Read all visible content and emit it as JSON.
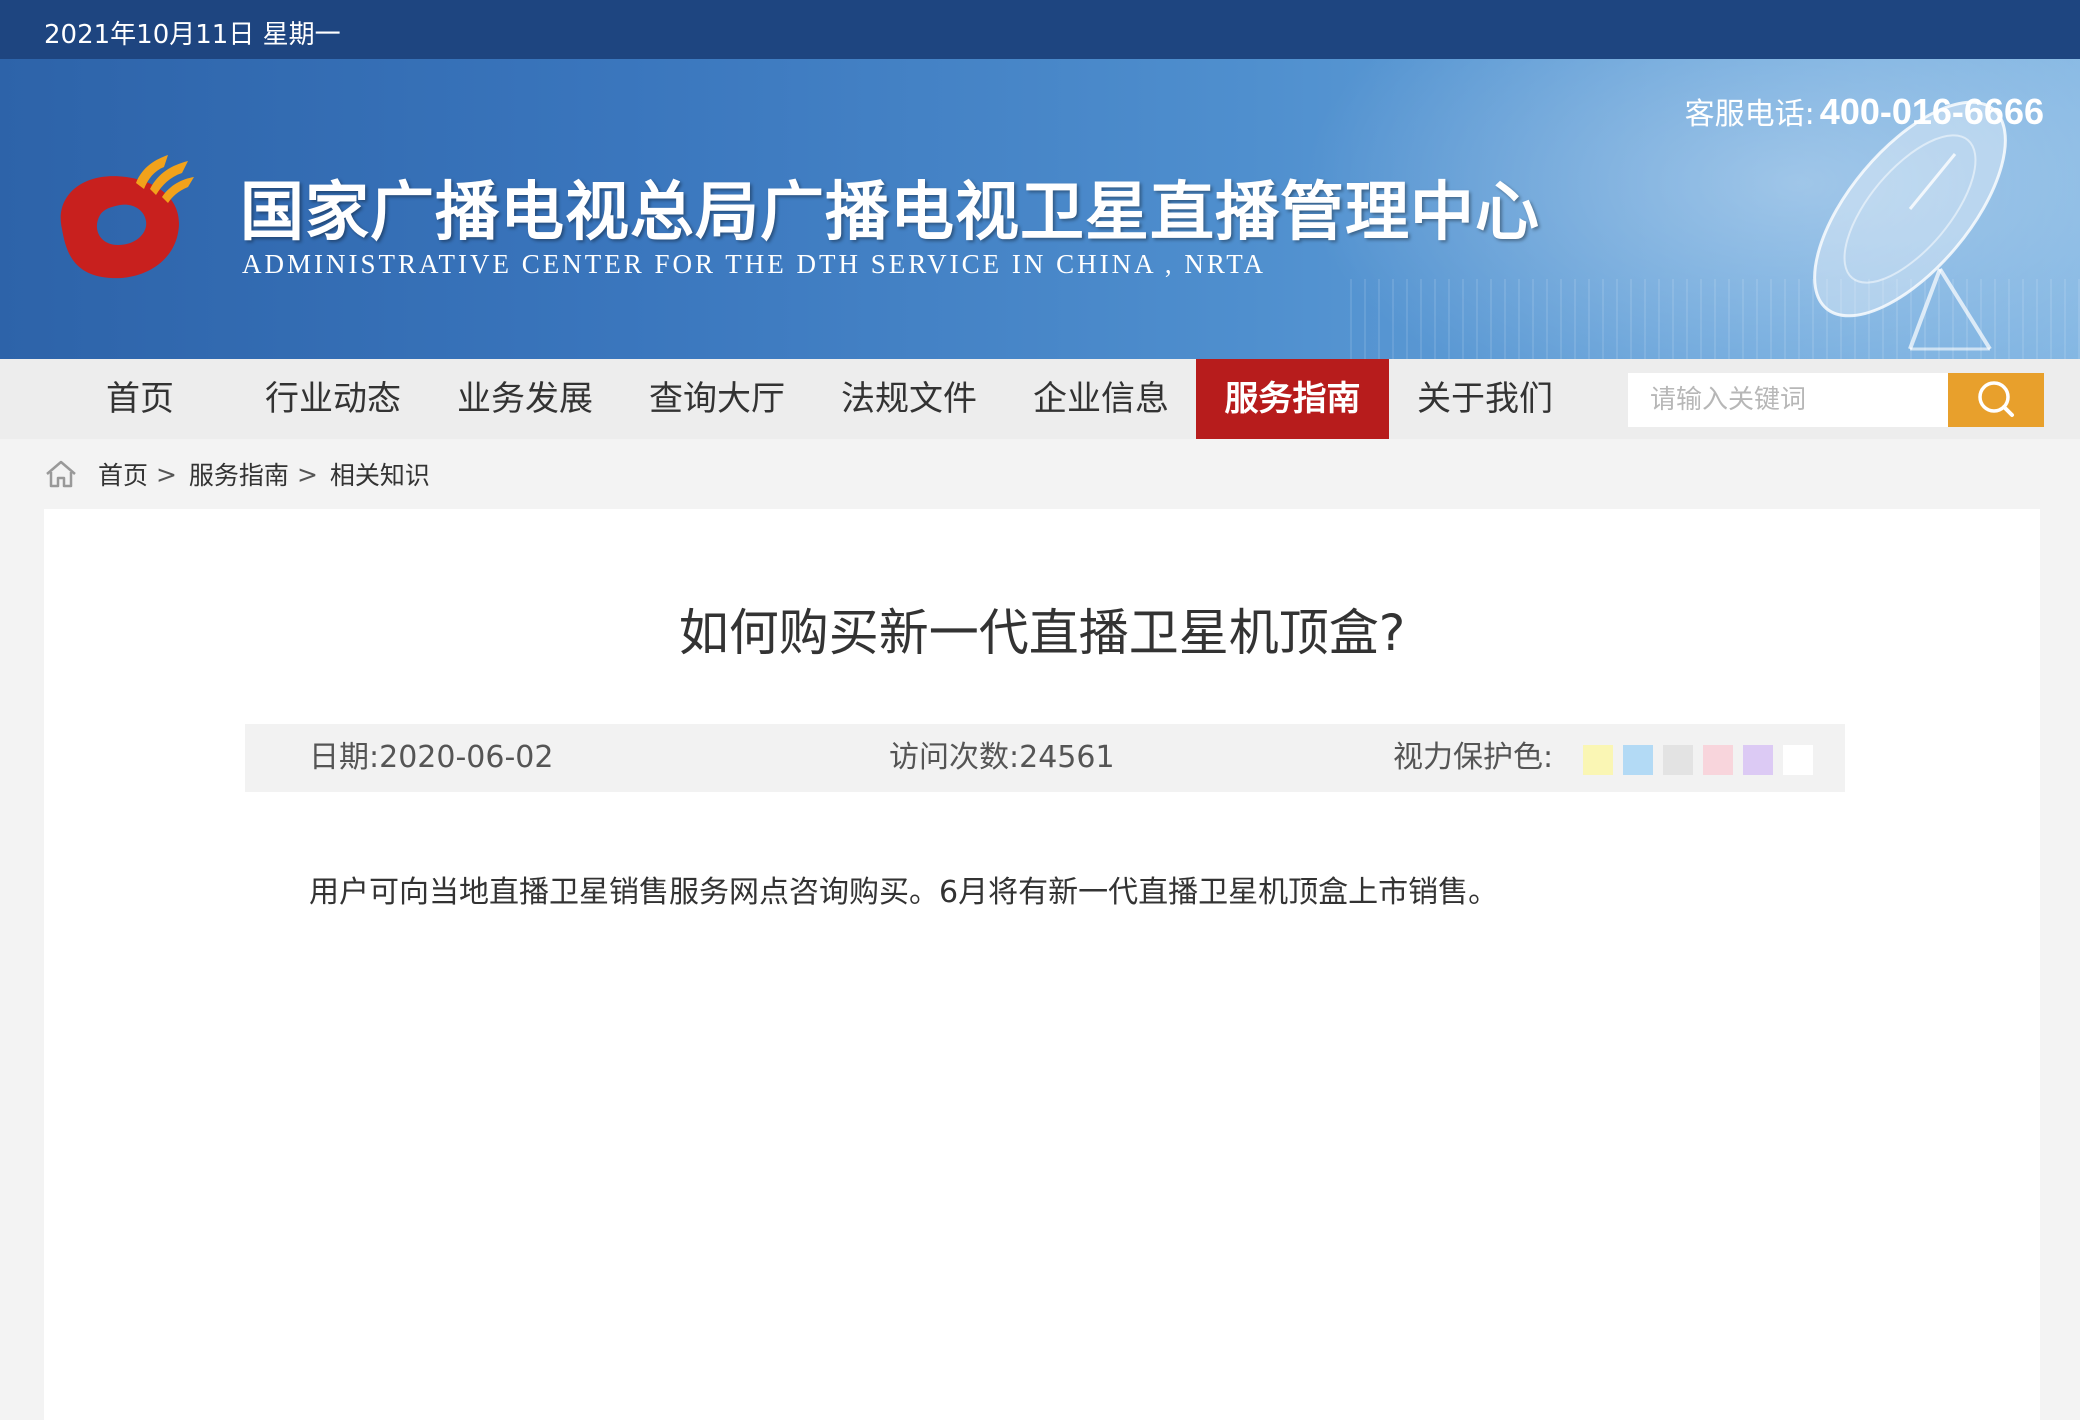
{
  "topbar": {
    "date": "2021年10月11日 星期一"
  },
  "header": {
    "hotline_label": "客服电话:",
    "hotline_number": "400-016-6666",
    "title_cn": "国家广播电视总局广播电视卫星直播管理中心",
    "title_en": "ADMINISTRATIVE CENTER FOR THE DTH SERVICE IN CHINA , NRTA"
  },
  "nav": {
    "items": [
      {
        "label": "首页"
      },
      {
        "label": "行业动态"
      },
      {
        "label": "业务发展"
      },
      {
        "label": "查询大厅"
      },
      {
        "label": "法规文件"
      },
      {
        "label": "企业信息"
      },
      {
        "label": "服务指南"
      },
      {
        "label": "关于我们"
      }
    ],
    "active": "服务指南",
    "search": {
      "placeholder": "请输入关键词",
      "value": "",
      "icon": "search-icon"
    }
  },
  "breadcrumb": {
    "icon": "home-icon",
    "items": [
      "首页",
      "服务指南",
      "相关知识"
    ],
    "separator": ">"
  },
  "article": {
    "title": "如何购买新一代直播卫星机顶盒?",
    "date_label": "日期:",
    "date": "2020-06-02",
    "visits_label": "访问次数:",
    "visits": "24561",
    "eye_protection_label": "视力保护色:",
    "eye_colors": [
      "#faf6b4",
      "#b3daf5",
      "#e3e3e3",
      "#f8d5dc",
      "#dccaf4",
      "#ffffff"
    ],
    "body": "用户可向当地直播卫星销售服务网点咨询购买。6月将有新一代直播卫星机顶盒上市销售。"
  },
  "colors": {
    "topbar": "#1e4580",
    "nav_active": "#b71c1c",
    "search_button": "#e8a02c",
    "logo_red": "#c8201e",
    "logo_orange": "#f2a21b"
  }
}
